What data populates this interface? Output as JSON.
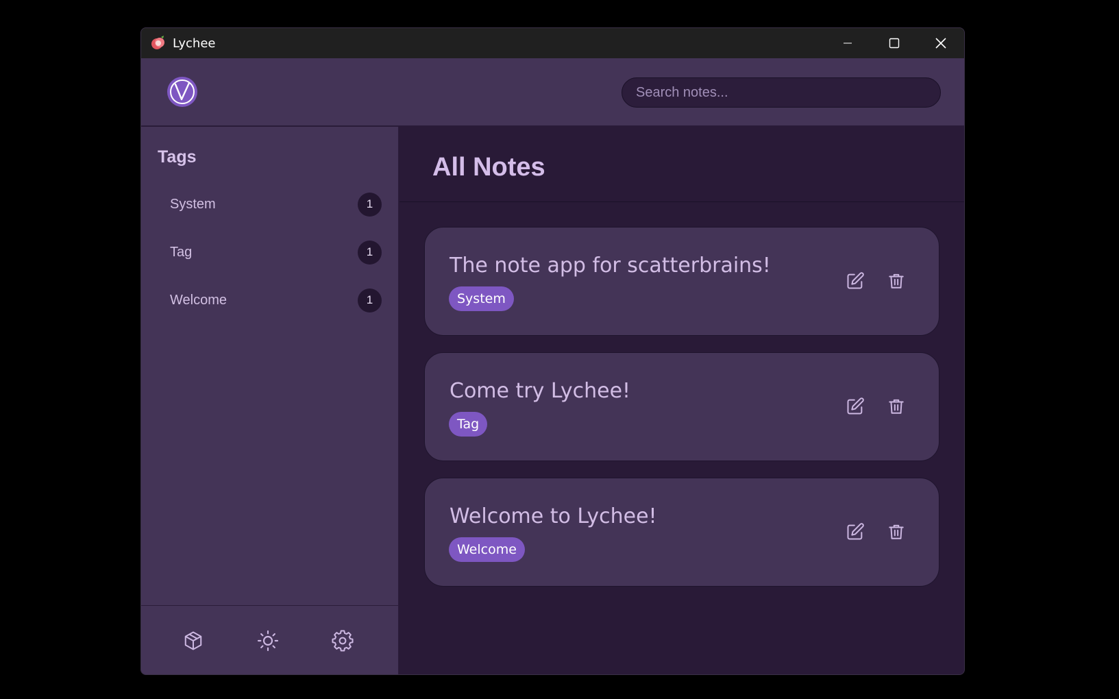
{
  "window": {
    "title": "Lychee",
    "icons": {
      "app": "lychee-fruit-icon",
      "minimize": "minimize-icon",
      "maximize": "maximize-icon",
      "close": "close-icon"
    }
  },
  "header": {
    "logo": "lychee-logo",
    "search": {
      "placeholder": "Search notes...",
      "value": ""
    }
  },
  "sidebar": {
    "heading": "Tags",
    "tags": [
      {
        "label": "System",
        "count": "1"
      },
      {
        "label": "Tag",
        "count": "1"
      },
      {
        "label": "Welcome",
        "count": "1"
      }
    ],
    "footer": [
      "package-icon",
      "sun-icon",
      "settings-gear-icon"
    ]
  },
  "main": {
    "title": "All Notes",
    "notes": [
      {
        "title": "The note app for scatterbrains!",
        "tag": "System"
      },
      {
        "title": "Come try Lychee!",
        "tag": "Tag"
      },
      {
        "title": "Welcome to Lychee!",
        "tag": "Welcome"
      }
    ]
  },
  "colors": {
    "panel": "#443457",
    "background": "#291a37",
    "accent": "#7e57c2",
    "text": "#d2bde5",
    "titlebar": "#202020"
  }
}
